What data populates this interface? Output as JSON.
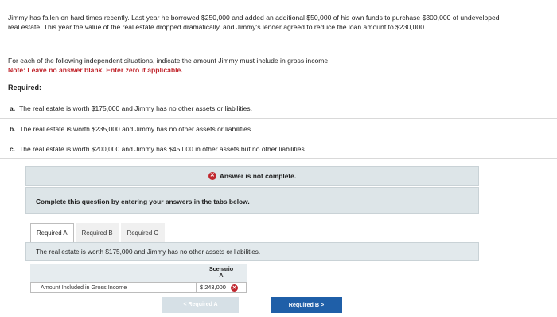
{
  "problem": {
    "intro": "Jimmy has fallen on hard times recently. Last year he borrowed $250,000 and added an additional $50,000 of his own funds to purchase $300,000 of undeveloped real estate. This year the value of the real estate dropped dramatically, and Jimmy's lender agreed to reduce the loan amount to $230,000.",
    "instruction": "For each of the following independent situations, indicate the amount Jimmy must include in gross income:",
    "note": "Note: Leave no answer blank. Enter zero if applicable.",
    "required_heading": "Required:",
    "parts": [
      {
        "letter": "a.",
        "text": "The real estate is worth $175,000 and Jimmy has no other assets or liabilities."
      },
      {
        "letter": "b.",
        "text": "The real estate is worth $235,000 and Jimmy has no other assets or liabilities."
      },
      {
        "letter": "c.",
        "text": "The real estate is worth $200,000 and Jimmy has $45,000 in other assets but no other liabilities."
      }
    ]
  },
  "status": {
    "icon": "close-circle-icon",
    "text": "Answer is not complete."
  },
  "complete_prompt": "Complete this question by entering your answers in the tabs below.",
  "tabs": [
    {
      "label": "Required A",
      "active": true
    },
    {
      "label": "Required B",
      "active": false
    },
    {
      "label": "Required C",
      "active": false
    }
  ],
  "tab_prompt": "The real estate is worth $175,000 and Jimmy has no other assets or liabilities.",
  "answer_table": {
    "col_header_line1": "Scenario",
    "col_header_line2": "A",
    "row_label": "Amount Included in Gross Income",
    "currency": "$",
    "value": "243,000",
    "value_status": "incorrect"
  },
  "nav": {
    "prev_label": "< Required A",
    "next_label": "Required B  >"
  },
  "colors": {
    "error_red": "#c0262d",
    "primary_blue": "#1f5fa8",
    "panel_gray": "#dde5e8"
  }
}
